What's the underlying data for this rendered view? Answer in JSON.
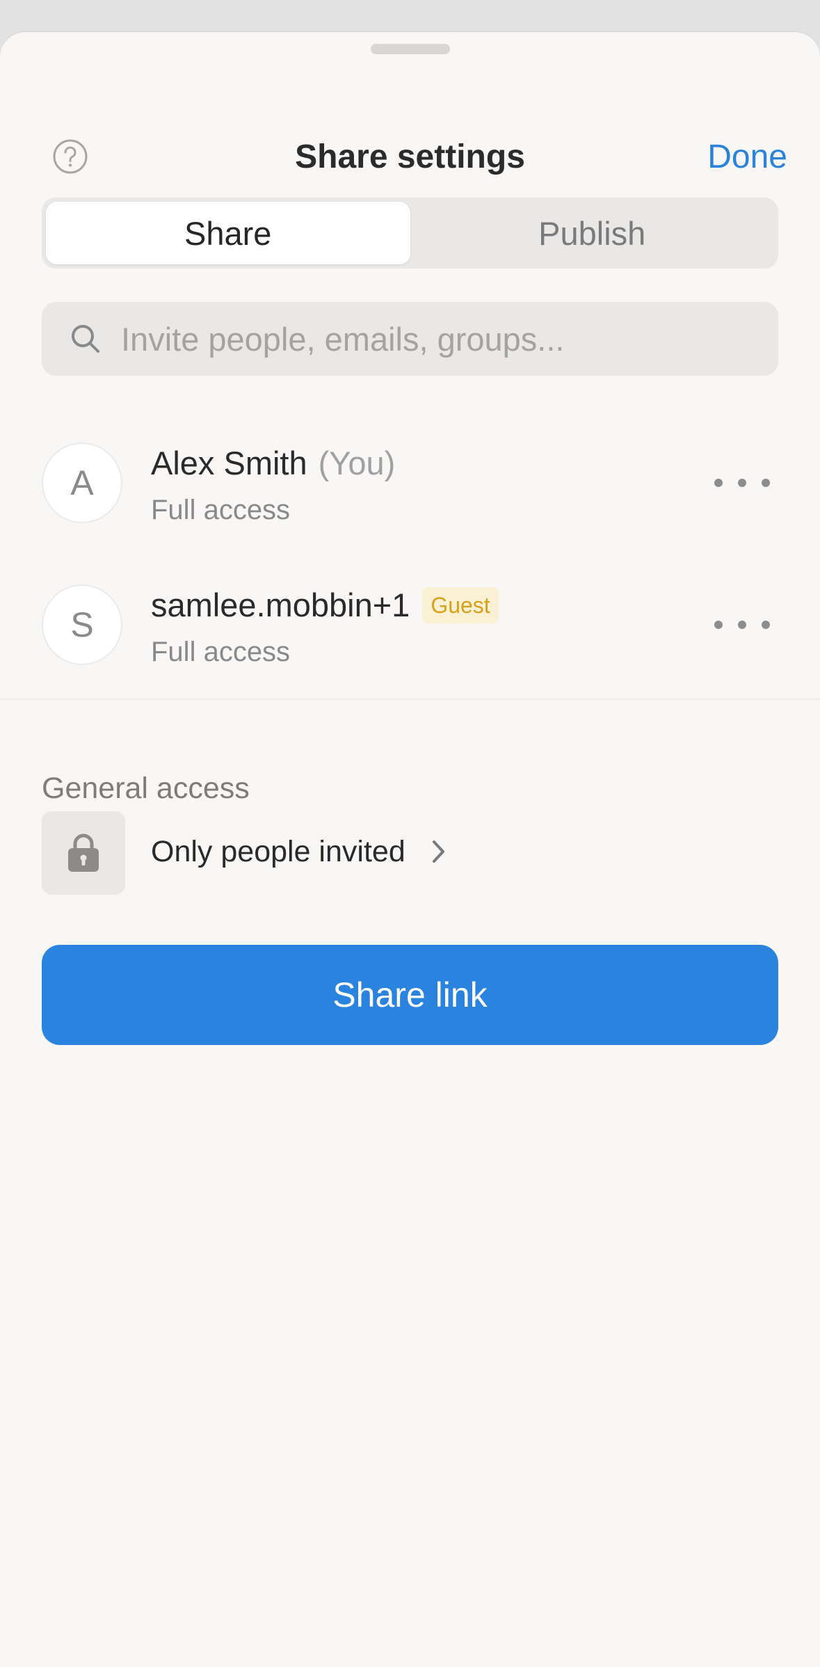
{
  "header": {
    "title": "Share settings",
    "done_label": "Done",
    "help_icon": "question-circle-icon"
  },
  "tabs": [
    {
      "label": "Share",
      "active": true
    },
    {
      "label": "Publish",
      "active": false
    }
  ],
  "search": {
    "placeholder": "Invite people, emails, groups...",
    "value": "",
    "icon": "search-icon"
  },
  "members": [
    {
      "initial": "A",
      "name": "Alex Smith",
      "you_label": "(You)",
      "access": "Full access"
    },
    {
      "initial": "S",
      "name": "samlee.mobbin+1",
      "badge": "Guest",
      "access": "Full access"
    }
  ],
  "general_access": {
    "label": "General access",
    "option": "Only people invited",
    "icon": "lock-icon"
  },
  "share_link_label": "Share link",
  "colors": {
    "accent": "#2a84dc",
    "guest_badge_text": "#d6a21a",
    "guest_badge_bg": "#faf0d4",
    "sheet_bg": "#f8f7f6"
  }
}
